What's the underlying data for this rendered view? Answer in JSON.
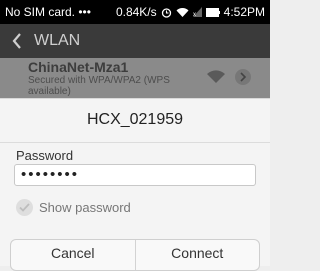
{
  "status_bar": {
    "carrier": "No SIM card. •••",
    "speed": "0.84K/s",
    "time": "4:52PM",
    "icons": [
      "alarm-icon",
      "wifi-icon",
      "signal-icon",
      "battery-icon"
    ]
  },
  "title_bar": {
    "title": "WLAN",
    "back_icon": "chevron-left-icon"
  },
  "network": {
    "name": "ChinaNet-Mza1",
    "security": "Secured with WPA/WPA2 (WPS",
    "security_more": "available)"
  },
  "dialog": {
    "ssid": "HCX_021959",
    "password_label": "Password",
    "password_value": "••••••••",
    "show_password_label": "Show password",
    "show_password_checked": false,
    "cancel_label": "Cancel",
    "connect_label": "Connect"
  },
  "colors": {
    "status_bar_bg": "#000000",
    "title_bar_bg": "#3a3a3a",
    "dialog_bg": "#f4f4f4"
  }
}
